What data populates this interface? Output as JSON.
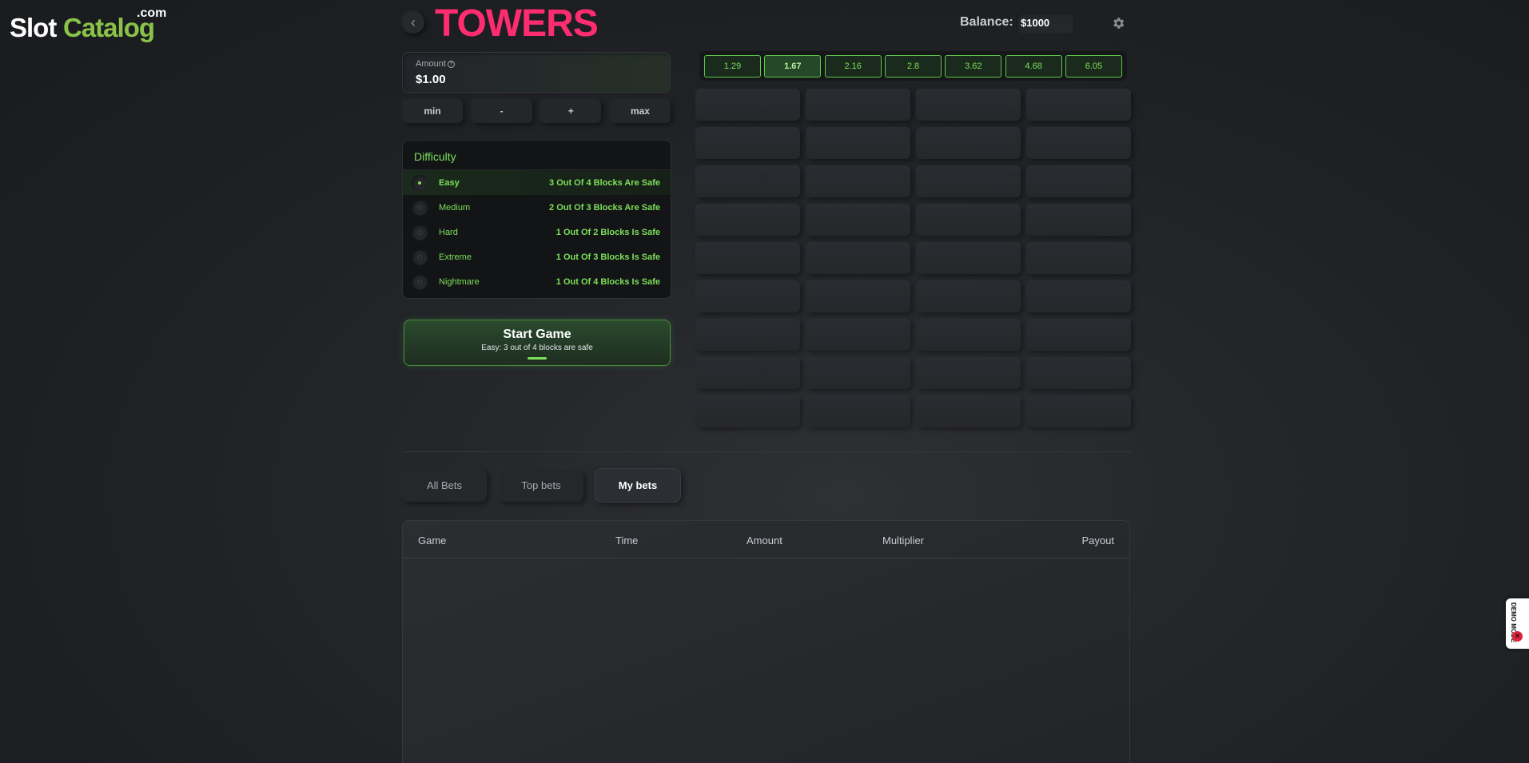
{
  "logo": {
    "slot": "Slot",
    "catalog": "Catalog",
    "com": ".com"
  },
  "header": {
    "back_icon": "chevron-left-icon",
    "title": "TOWERS",
    "balance_label": "Balance:",
    "balance_value": "$1000",
    "settings_icon": "gear-icon"
  },
  "amount": {
    "label": "Amount",
    "value": "$1.00",
    "buttons": [
      "min",
      "-",
      "+",
      "max"
    ]
  },
  "difficulty": {
    "header": "Difficulty",
    "selected": "Easy",
    "options": [
      {
        "name": "Easy",
        "desc": "3 Out Of 4 Blocks Are Safe"
      },
      {
        "name": "Medium",
        "desc": "2 Out Of 3 Blocks Are Safe"
      },
      {
        "name": "Hard",
        "desc": "1 Out Of 2 Blocks Is Safe"
      },
      {
        "name": "Extreme",
        "desc": "1 Out Of 3 Blocks Is Safe"
      },
      {
        "name": "Nightmare",
        "desc": "1 Out Of 4 Blocks Is Safe"
      }
    ]
  },
  "start_game": {
    "title": "Start Game",
    "subtitle": "Easy: 3 out of 4 blocks are safe"
  },
  "multipliers": [
    "1.29",
    "1.67",
    "2.16",
    "2.8",
    "3.62",
    "4.68",
    "6.05"
  ],
  "highlighted_multiplier": "1.67",
  "grid": {
    "rows": 9,
    "cols": 4
  },
  "bet_tabs": [
    "All Bets",
    "Top bets",
    "My bets"
  ],
  "active_bet_tab": "My bets",
  "table": {
    "columns": [
      "Game",
      "Time",
      "Amount",
      "Multiplier",
      "Payout"
    ]
  },
  "demo_badge": {
    "text": "DEMO MODE",
    "icon": "close-icon"
  },
  "colors": {
    "accent_green": "#7be059",
    "title_pink": "#ff2d6f",
    "brand_green": "#8bc34a"
  }
}
